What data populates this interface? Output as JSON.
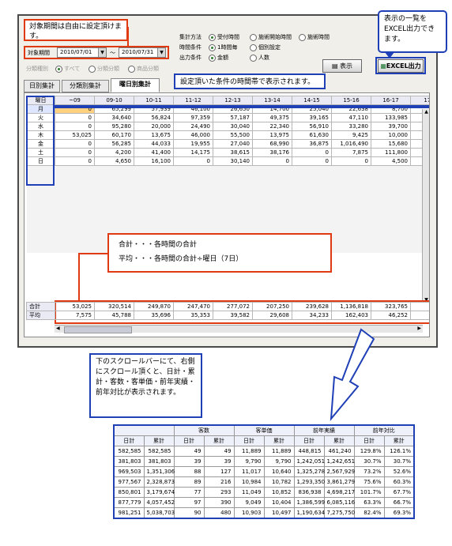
{
  "callouts": {
    "period_note": "対象期間は自由に設定頂けます。",
    "excel_note": "表示の一覧をEXCEL出力できます。",
    "condition_note": "設定頂いた条件の時間帯で表示されます。",
    "sum_line": "合計・・・各時間の合計",
    "avg_line": "平均・・・各時間の合計÷曜日（7日）",
    "scroll_note": "下のスクロールバーにて、右側にスクロール頂くと、日計・累計・客数・客単価・前年実績・前年対比が表示されます。"
  },
  "filters": {
    "period_label": "対象期間",
    "date_from": "2010/07/01",
    "tilde": "～",
    "date_to": "2010/07/31",
    "class_label": "分類種別",
    "class_options": [
      "すべて",
      "分類分類",
      "商品分類"
    ],
    "method_label": "集計方法",
    "method_options": [
      "受付時間",
      "施術開始時間",
      "施術時間"
    ],
    "time_label": "時間条件",
    "time_options": [
      "1時間毎",
      "個別設定"
    ],
    "output_label": "出力条件",
    "output_options": [
      "金額",
      "人数"
    ]
  },
  "buttons": {
    "display": "表示",
    "excel": "EXCEL出力"
  },
  "tabs": [
    "日別集計",
    "分類別集計",
    "曜日別集計"
  ],
  "grid": {
    "corner": "曜日",
    "columns": [
      "~09",
      "09-10",
      "10-11",
      "11-12",
      "12-13",
      "13-14",
      "14-15",
      "15-16",
      "16-17",
      "17-18"
    ],
    "rows": [
      {
        "day": "月",
        "values": [
          "0",
          "65,299",
          "57,939",
          "46,100",
          "26,650",
          "14,700",
          "25,040",
          "22,638",
          "8,700",
          "152,7"
        ]
      },
      {
        "day": "火",
        "values": [
          "0",
          "34,640",
          "56,824",
          "97,359",
          "57,187",
          "49,375",
          "39,165",
          "47,110",
          "133,985",
          "105,6"
        ]
      },
      {
        "day": "水",
        "values": [
          "0",
          "95,280",
          "20,000",
          "24,490",
          "30,040",
          "22,340",
          "56,910",
          "33,280",
          "39,700",
          "27,6"
        ]
      },
      {
        "day": "木",
        "values": [
          "53,025",
          "60,170",
          "13,675",
          "46,000",
          "55,500",
          "13,975",
          "61,630",
          "9,425",
          "10,000",
          "42,3"
        ]
      },
      {
        "day": "金",
        "values": [
          "0",
          "56,285",
          "44,033",
          "19,955",
          "27,040",
          "68,990",
          "36,875",
          "1,016,490",
          "15,680",
          "22,5"
        ]
      },
      {
        "day": "土",
        "values": [
          "0",
          "4,200",
          "41,400",
          "14,175",
          "38,615",
          "38,176",
          "0",
          "7,875",
          "111,800",
          "10,0"
        ]
      },
      {
        "day": "日",
        "values": [
          "0",
          "4,650",
          "16,100",
          "0",
          "30,140",
          "0",
          "0",
          "0",
          "4,500",
          "42"
        ]
      }
    ],
    "footer": [
      {
        "label": "合計",
        "values": [
          "53,025",
          "320,514",
          "249,870",
          "247,470",
          "277,072",
          "207,250",
          "239,628",
          "1,136,818",
          "323,765",
          "365,4"
        ]
      },
      {
        "label": "平均",
        "values": [
          "7,575",
          "45,788",
          "35,696",
          "35,353",
          "39,582",
          "29,608",
          "34,233",
          "162,403",
          "46,252",
          "52,2"
        ]
      }
    ]
  },
  "result_table": {
    "groups": [
      "客数",
      "客単価",
      "前年実績",
      "前年対比"
    ],
    "headers": [
      "日計",
      "累計",
      "日計",
      "累計",
      "日計",
      "累計",
      "日計",
      "累計",
      "日計",
      "累計"
    ],
    "rows": [
      [
        "582,585",
        "582,585",
        "49",
        "49",
        "11,889",
        "11,889",
        "448,815",
        "461,240",
        "129.8%",
        "126.1%"
      ],
      [
        "381,803",
        "381,803",
        "39",
        "39",
        "9,790",
        "9,790",
        "1,242,051",
        "1,242,651",
        "30.7%",
        "30.7%"
      ],
      [
        "969,503",
        "1,351,306",
        "88",
        "127",
        "11,017",
        "10,640",
        "1,325,278",
        "2,567,929",
        "73.2%",
        "52.6%"
      ],
      [
        "977,567",
        "2,328,873",
        "89",
        "216",
        "10,984",
        "10,782",
        "1,293,350",
        "3,861,279",
        "75.6%",
        "60.3%"
      ],
      [
        "850,801",
        "3,179,674",
        "77",
        "293",
        "11,049",
        "10,852",
        "836,938",
        "4,698,217",
        "101.7%",
        "67.7%"
      ],
      [
        "877,779",
        "4,057,452",
        "97",
        "390",
        "9,049",
        "10,404",
        "1,386,599",
        "6,085,116",
        "63.3%",
        "66.7%"
      ],
      [
        "981,251",
        "5,038,703",
        "90",
        "480",
        "10,903",
        "10,497",
        "1,190,634",
        "7,275,750",
        "82.4%",
        "69.3%"
      ]
    ]
  },
  "colors": {
    "callout_red": "#e03a12",
    "callout_blue": "#1f3fb7",
    "highlight_cell": "#ffd080"
  }
}
